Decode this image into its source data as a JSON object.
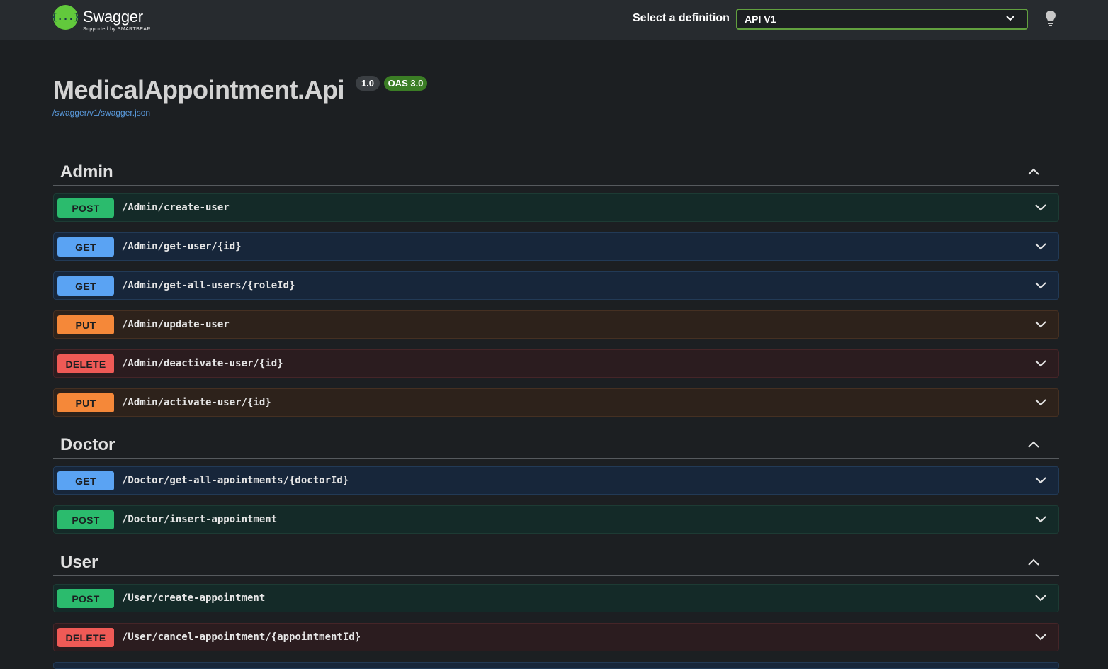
{
  "topbar": {
    "logo_name": "Swagger",
    "logo_glyph": "{...}",
    "logo_sub": "Supported by SMARTBEAR",
    "select_label": "Select a definition",
    "select_value": "API V1",
    "brand_color": "#62c93c"
  },
  "info": {
    "title": "MedicalAppointment.Api",
    "version": "1.0",
    "oas": "OAS 3.0",
    "spec_link": "/swagger/v1/swagger.json"
  },
  "tags": [
    {
      "name": "Admin"
    },
    {
      "name": "Doctor"
    },
    {
      "name": "User"
    }
  ],
  "operations": [
    {
      "method": "POST",
      "path": "/Admin/create-user"
    },
    {
      "method": "GET",
      "path": "/Admin/get-user/{id}"
    },
    {
      "method": "GET",
      "path": "/Admin/get-all-users/{roleId}"
    },
    {
      "method": "PUT",
      "path": "/Admin/update-user"
    },
    {
      "method": "DELETE",
      "path": "/Admin/deactivate-user/{id}"
    },
    {
      "method": "PUT",
      "path": "/Admin/activate-user/{id}"
    },
    {
      "method": "GET",
      "path": "/Doctor/get-all-apointments/{doctorId}"
    },
    {
      "method": "POST",
      "path": "/Doctor/insert-appointment"
    },
    {
      "method": "POST",
      "path": "/User/create-appointment"
    },
    {
      "method": "DELETE",
      "path": "/User/cancel-appointment/{appointmentId}"
    }
  ],
  "colors": {
    "post": "#2bbb6d",
    "get": "#5aa3f3",
    "put": "#f58839",
    "delete": "#ef5a56"
  }
}
